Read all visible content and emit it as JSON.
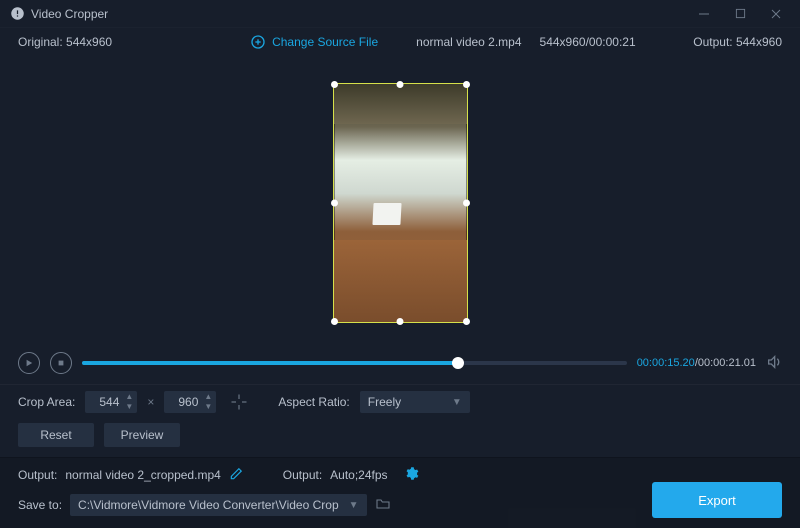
{
  "titlebar": {
    "title": "Video Cropper"
  },
  "infobar": {
    "original_label": "Original:",
    "original_value": "544x960",
    "change_label": "Change Source File",
    "filename": "normal video 2.mp4",
    "resolution_time": "544x960/00:00:21",
    "output_label": "Output:",
    "output_value": "544x960"
  },
  "playback": {
    "current_time": "00:00:15.20",
    "total_time": "00:00:21.01"
  },
  "settings": {
    "crop_label": "Crop Area:",
    "crop_w": "544",
    "crop_h": "960",
    "aspect_label": "Aspect Ratio:",
    "aspect_value": "Freely",
    "reset_label": "Reset",
    "preview_label": "Preview"
  },
  "output": {
    "output_label": "Output:",
    "output_file": "normal video 2_cropped.mp4",
    "format_label": "Output:",
    "format_value": "Auto;24fps"
  },
  "save": {
    "save_label": "Save to:",
    "path": "C:\\Vidmore\\Vidmore Video Converter\\Video Crop",
    "export_label": "Export"
  }
}
